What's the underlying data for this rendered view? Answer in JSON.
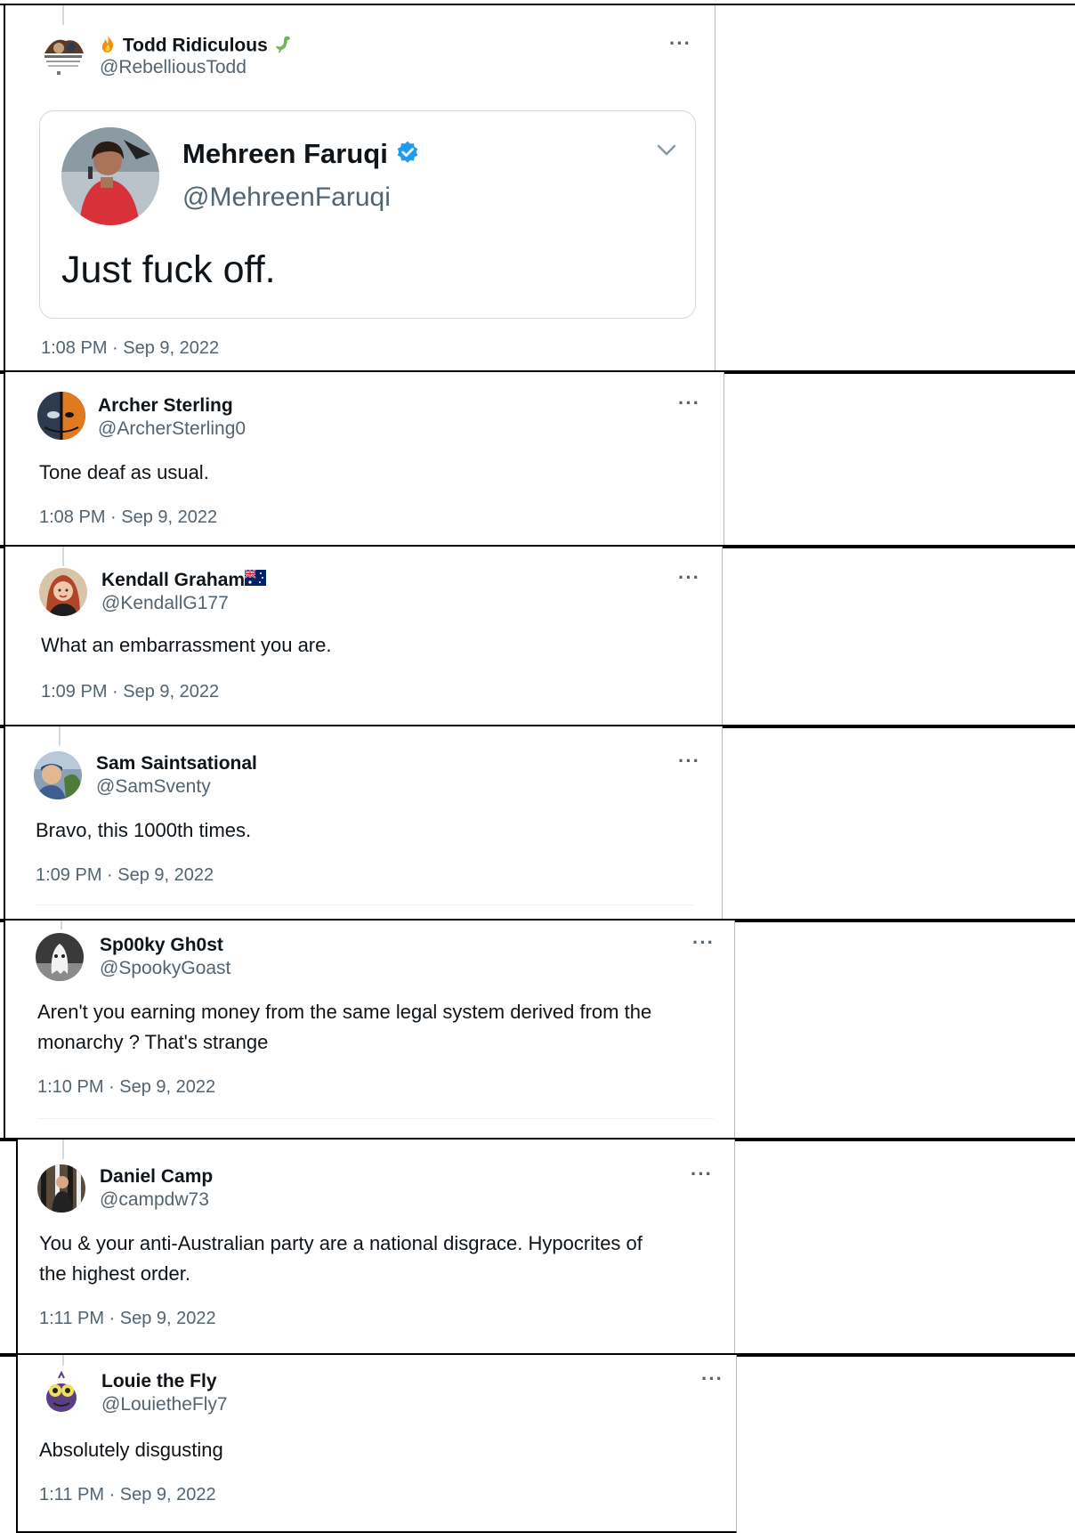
{
  "more_label": "···",
  "tweets": [
    {
      "name": "Todd Ridiculous",
      "name_prefix_emoji": "fire-icon",
      "name_suffix_emoji": "dinosaur-icon",
      "handle": "@RebelliousTodd",
      "timestamp": "1:08 PM · Sep 9, 2022",
      "quote": {
        "name": "Mehreen Faruqi",
        "verified": true,
        "handle": "@MehreenFaruqi",
        "text": "Just fuck off."
      }
    },
    {
      "name": "Archer Sterling",
      "handle": "@ArcherSterling0",
      "text": "Tone deaf as usual.",
      "timestamp": "1:08 PM · Sep 9, 2022"
    },
    {
      "name": "Kendall Graham",
      "name_suffix_emoji": "australia-flag-icon",
      "handle": "@KendallG177",
      "text": "What an embarrassment you are.",
      "timestamp": "1:09 PM · Sep 9, 2022"
    },
    {
      "name": "Sam Saintsational",
      "handle": "@SamSventy",
      "text": "Bravo, this 1000th times.",
      "timestamp": "1:09 PM · Sep 9, 2022"
    },
    {
      "name": "Sp00ky Gh0st",
      "handle": "@SpookyGoast",
      "text_line1": "Aren't you earning money from the same legal system derived from the",
      "text_line2": "monarchy ? That's strange",
      "timestamp": "1:10 PM · Sep 9, 2022"
    },
    {
      "name": "Daniel Camp",
      "handle": "@campdw73",
      "text_line1": "You & your anti-Australian party are a national disgrace. Hypocrites of",
      "text_line2": "the highest order.",
      "timestamp": "1:11 PM · Sep 9, 2022"
    },
    {
      "name": "Louie the Fly",
      "handle": "@LouietheFly7",
      "text": "Absolutely disgusting",
      "timestamp": "1:11 PM · Sep 9, 2022"
    }
  ],
  "colors": {
    "text_primary": "#0f1419",
    "text_secondary": "#536471",
    "verified_blue": "#1d9bf0",
    "thread_line": "#cfd9de"
  }
}
